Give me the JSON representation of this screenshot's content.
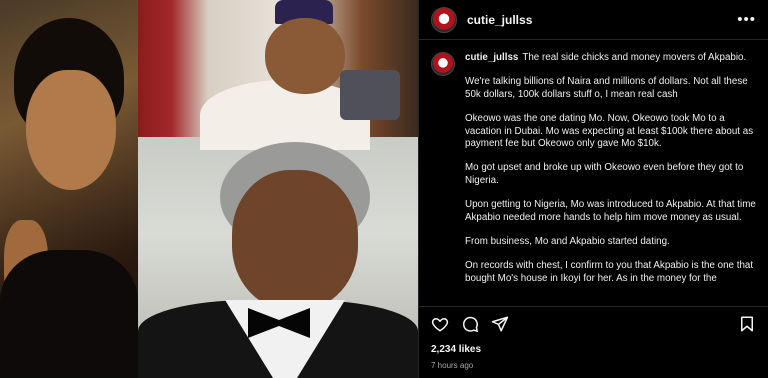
{
  "post": {
    "username": "cutie_jullss",
    "more_icon": "more-horizontal-icon",
    "caption_username": "cutie_jullss",
    "caption_paragraphs": [
      "The real side chicks and money movers of Akpabio.",
      "We're talking billions of Naira and millions of dollars. Not all these 50k dollars, 100k dollars stuff o, I mean real cash",
      "Okeowo was the one dating Mo. Now, Okeowo took Mo to a vacation in Dubai. Mo was expecting at least $100k there about as payment fee but Okeowo only gave Mo $10k.",
      "Mo got upset and broke up with Okeowo even before they got to Nigeria.",
      "Upon getting to Nigeria, Mo was introduced to Akpabio. At that time Akpabio needed more hands to help him move money as usual.",
      "From business, Mo and Akpabio started dating.",
      "On records with chest, I confirm to you that Akpabio is the one that bought Mo's house in Ikoyi for her. As in the money for the"
    ],
    "likes": "2,234 likes",
    "time": "7 hours ago"
  },
  "icons": {
    "like": "heart-icon",
    "comment": "comment-icon",
    "share": "send-icon",
    "save": "bookmark-icon"
  },
  "colors": {
    "background": "#000000",
    "text": "#f5f5f5",
    "muted": "#a8a8a8",
    "divider": "#262626"
  }
}
